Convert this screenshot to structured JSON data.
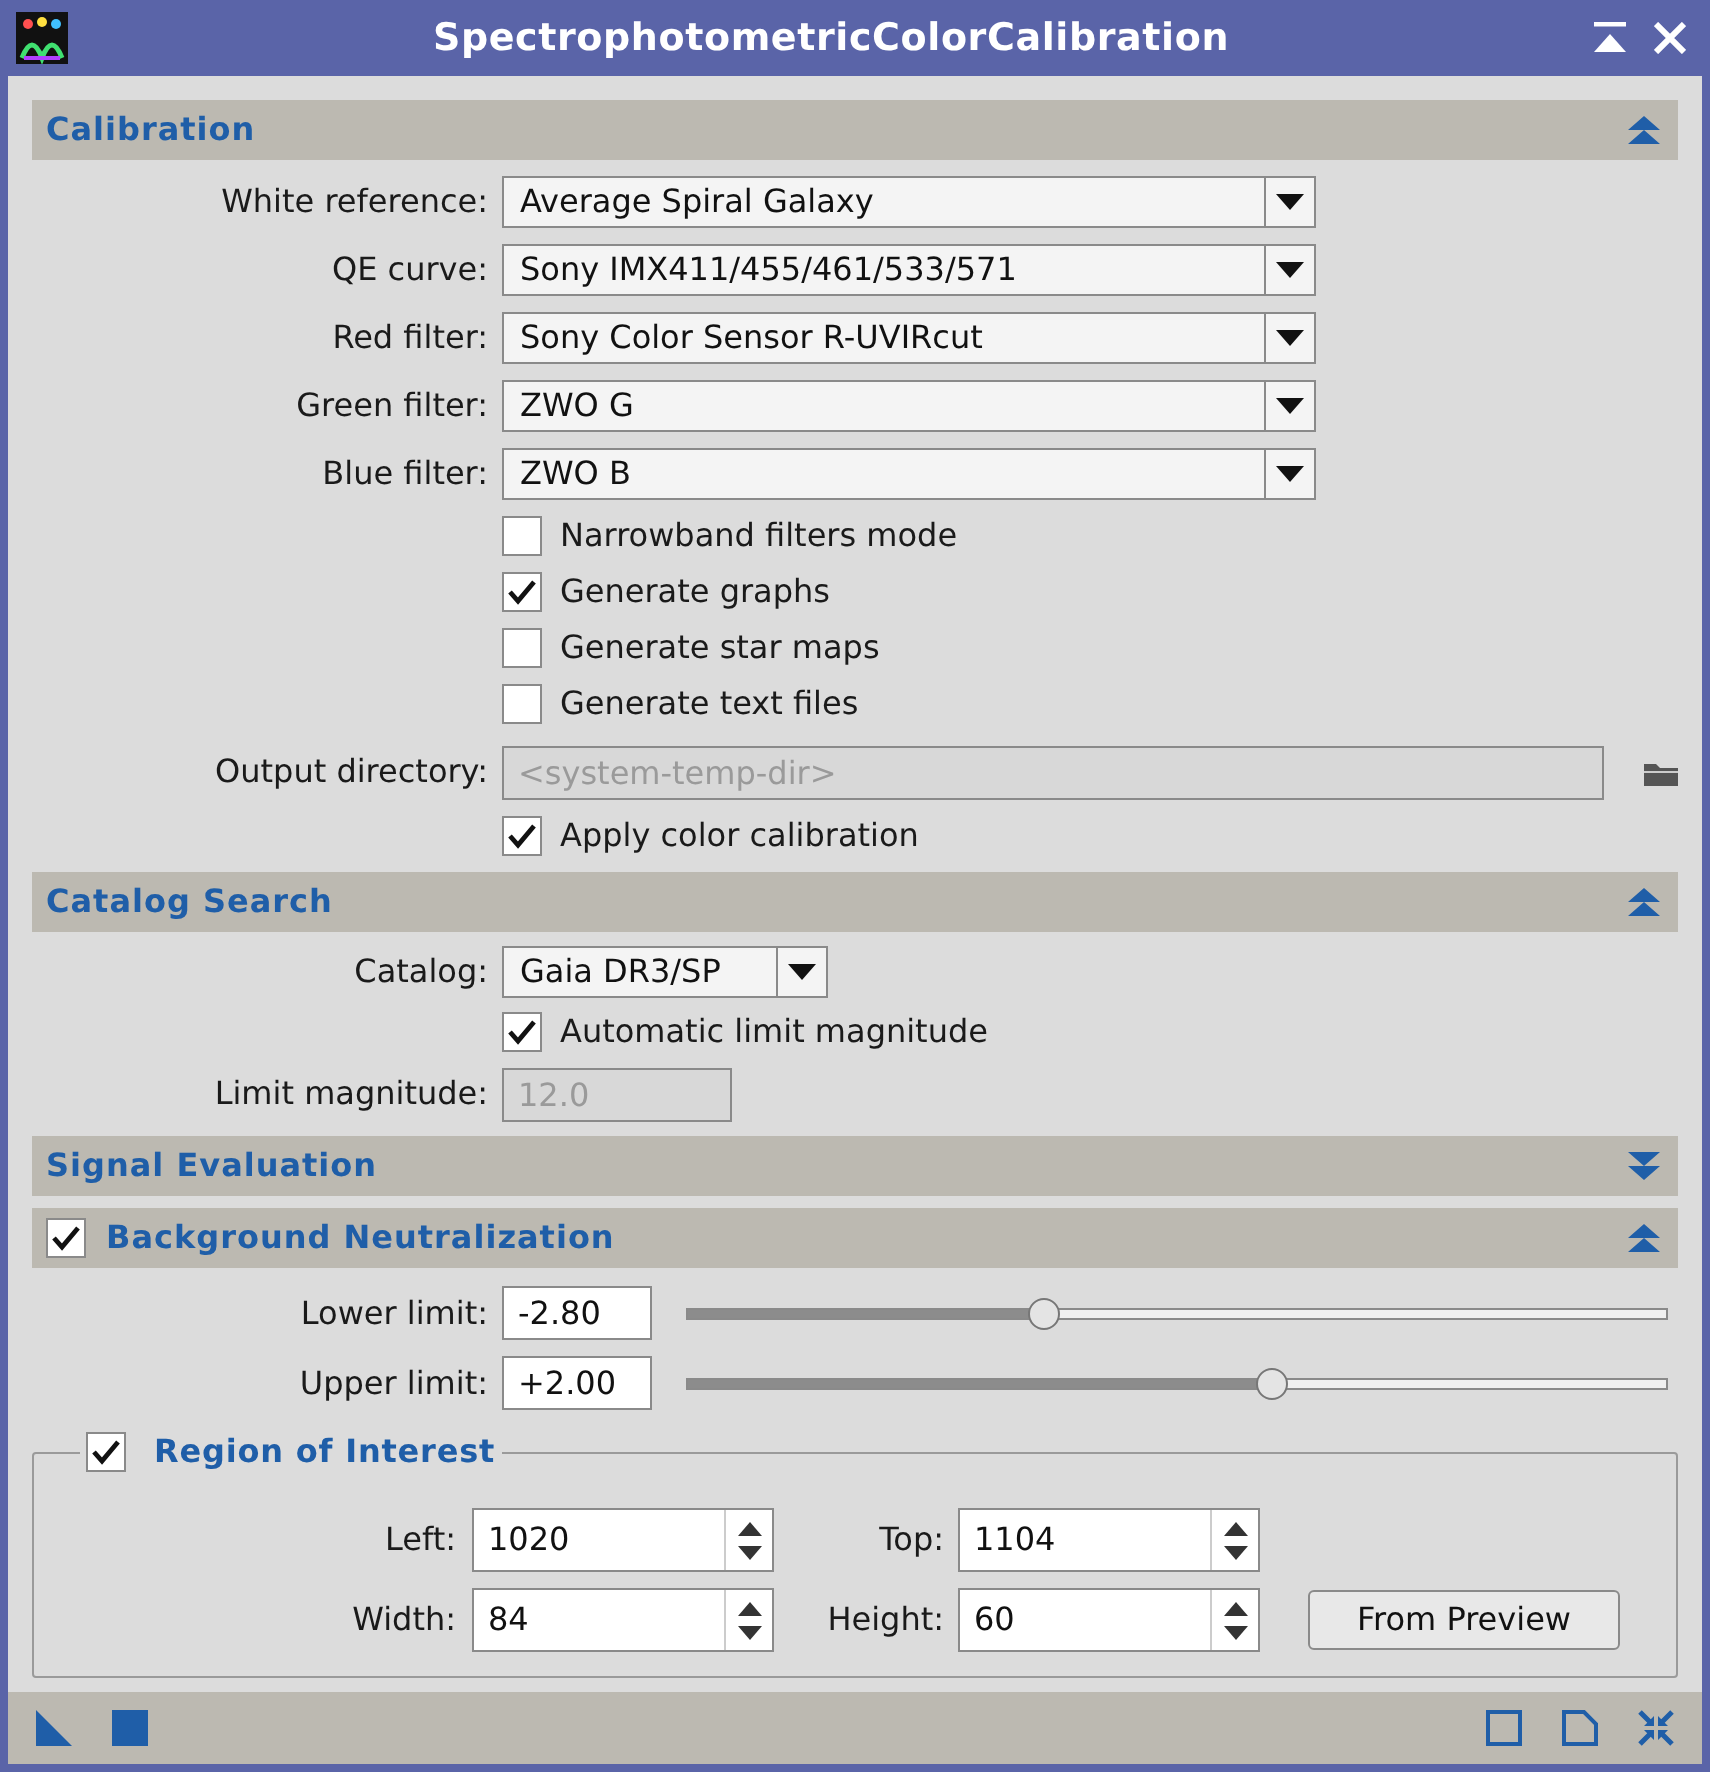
{
  "window": {
    "title": "SpectrophotometricColorCalibration"
  },
  "calibration": {
    "title": "Calibration",
    "expanded": true,
    "combos": [
      {
        "label": "White reference:",
        "value": "Average Spiral Galaxy"
      },
      {
        "label": "QE curve:",
        "value": "Sony IMX411/455/461/533/571"
      },
      {
        "label": "Red filter:",
        "value": "Sony Color Sensor R-UVIRcut"
      },
      {
        "label": "Green filter:",
        "value": "ZWO G"
      },
      {
        "label": "Blue filter:",
        "value": "ZWO B"
      }
    ],
    "options": [
      {
        "label": "Narrowband filters mode",
        "checked": false
      },
      {
        "label": "Generate graphs",
        "checked": true
      },
      {
        "label": "Generate star maps",
        "checked": false
      },
      {
        "label": "Generate text files",
        "checked": false
      }
    ],
    "output_directory": {
      "label": "Output directory:",
      "placeholder": "<system-temp-dir>",
      "disabled": true
    },
    "apply": {
      "label": "Apply color calibration",
      "checked": true
    }
  },
  "catalog_search": {
    "title": "Catalog Search",
    "expanded": true,
    "catalog": {
      "label": "Catalog:",
      "value": "Gaia DR3/SP"
    },
    "automatic": {
      "label": "Automatic limit magnitude",
      "checked": true
    },
    "limit_magnitude": {
      "label": "Limit magnitude:",
      "value": "12.0",
      "disabled": true
    }
  },
  "signal_evaluation": {
    "title": "Signal Evaluation",
    "expanded": false
  },
  "background_neutralization": {
    "title": "Background Neutralization",
    "expanded": true,
    "checked": true,
    "limits": [
      {
        "label": "Lower limit:",
        "value": "-2.80",
        "level": 0.364
      },
      {
        "label": "Upper limit:",
        "value": "+2.00",
        "level": 0.597
      }
    ],
    "region": {
      "title": "Region of Interest",
      "checked": true,
      "fields": [
        {
          "label": "Left:",
          "value": "1020"
        },
        {
          "label": "Top:",
          "value": "1104"
        },
        {
          "label": "Width:",
          "value": "84"
        },
        {
          "label": "Height:",
          "value": "60"
        }
      ],
      "button": "From Preview"
    }
  }
}
